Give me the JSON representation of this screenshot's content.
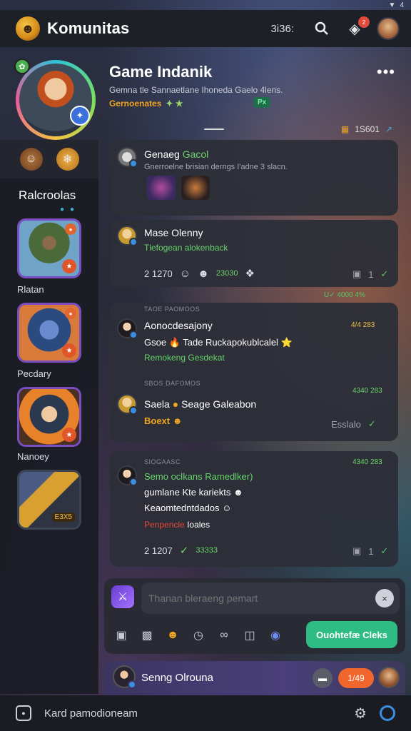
{
  "status_bar": {
    "battery": "4"
  },
  "top_bar": {
    "title": "Komunitas",
    "code": "3i36:",
    "notif_count": "2"
  },
  "header": {
    "game_name": "Game Indanik",
    "description": "Gemna tle Sannaetlane Ihoneda Gaelo 4lens.",
    "tagline": "Gernoenates",
    "tagline_extra": "✦ ★",
    "tag_badge": "Px",
    "stats_value": "1S601"
  },
  "sidebar": {
    "title": "Ralcroolas",
    "cards": [
      {
        "label": "Rlatan"
      },
      {
        "label": "Pecdary"
      },
      {
        "label": "Nanoey"
      },
      {
        "label": "",
        "price": "E3X5"
      }
    ]
  },
  "posts": [
    {
      "name": "Genaeg",
      "name_highlight": "Gacol",
      "sub": "Gnerroelne brisian derngs I'adne 3 slacn."
    },
    {
      "name": "Mase Olenny",
      "green": "Tlefogean alokenback",
      "count": "2 1270",
      "green_count": "23030",
      "read": "1"
    },
    {
      "label": "TAOE PAOMOOS",
      "name": "Aonocdesajony",
      "line2": "Gsoe 🔥 Tade Ruckapokublcalel ⭐",
      "green": "Remokeng Gesdekat",
      "time": "4/4 283",
      "top_info": "U✓ 4000 4%"
    },
    {
      "label": "SBOS DAFOMOS",
      "name": "Saela",
      "name_rest": "Seage Galeabon",
      "orange": "Boext",
      "time": "4340 283",
      "read": "Esslalo"
    },
    {
      "label": "SIOGAASC",
      "name": "Semo oclkans Ramedlker)",
      "line2": "gumlane Kte kariekts",
      "line3": "Keaomtedntdados",
      "red": "Penpencle",
      "red_rest": "Ioales",
      "time": "4340 283",
      "count": "2 1207",
      "green_count": "33333",
      "read": "1"
    }
  ],
  "composer": {
    "placeholder": "Thanan bleraeng pemart",
    "send_label": "Ouohtefæ Cleks"
  },
  "voice_bar": {
    "label": "Senng Olrouna",
    "count": "1/49"
  },
  "bottom_bar": {
    "label": "Kard pamodioneam"
  },
  "colors": {
    "accent_green": "#2fbb84",
    "accent_orange": "#f0662d",
    "highlight_green": "#6cd36b",
    "highlight_gold": "#f0a623"
  }
}
